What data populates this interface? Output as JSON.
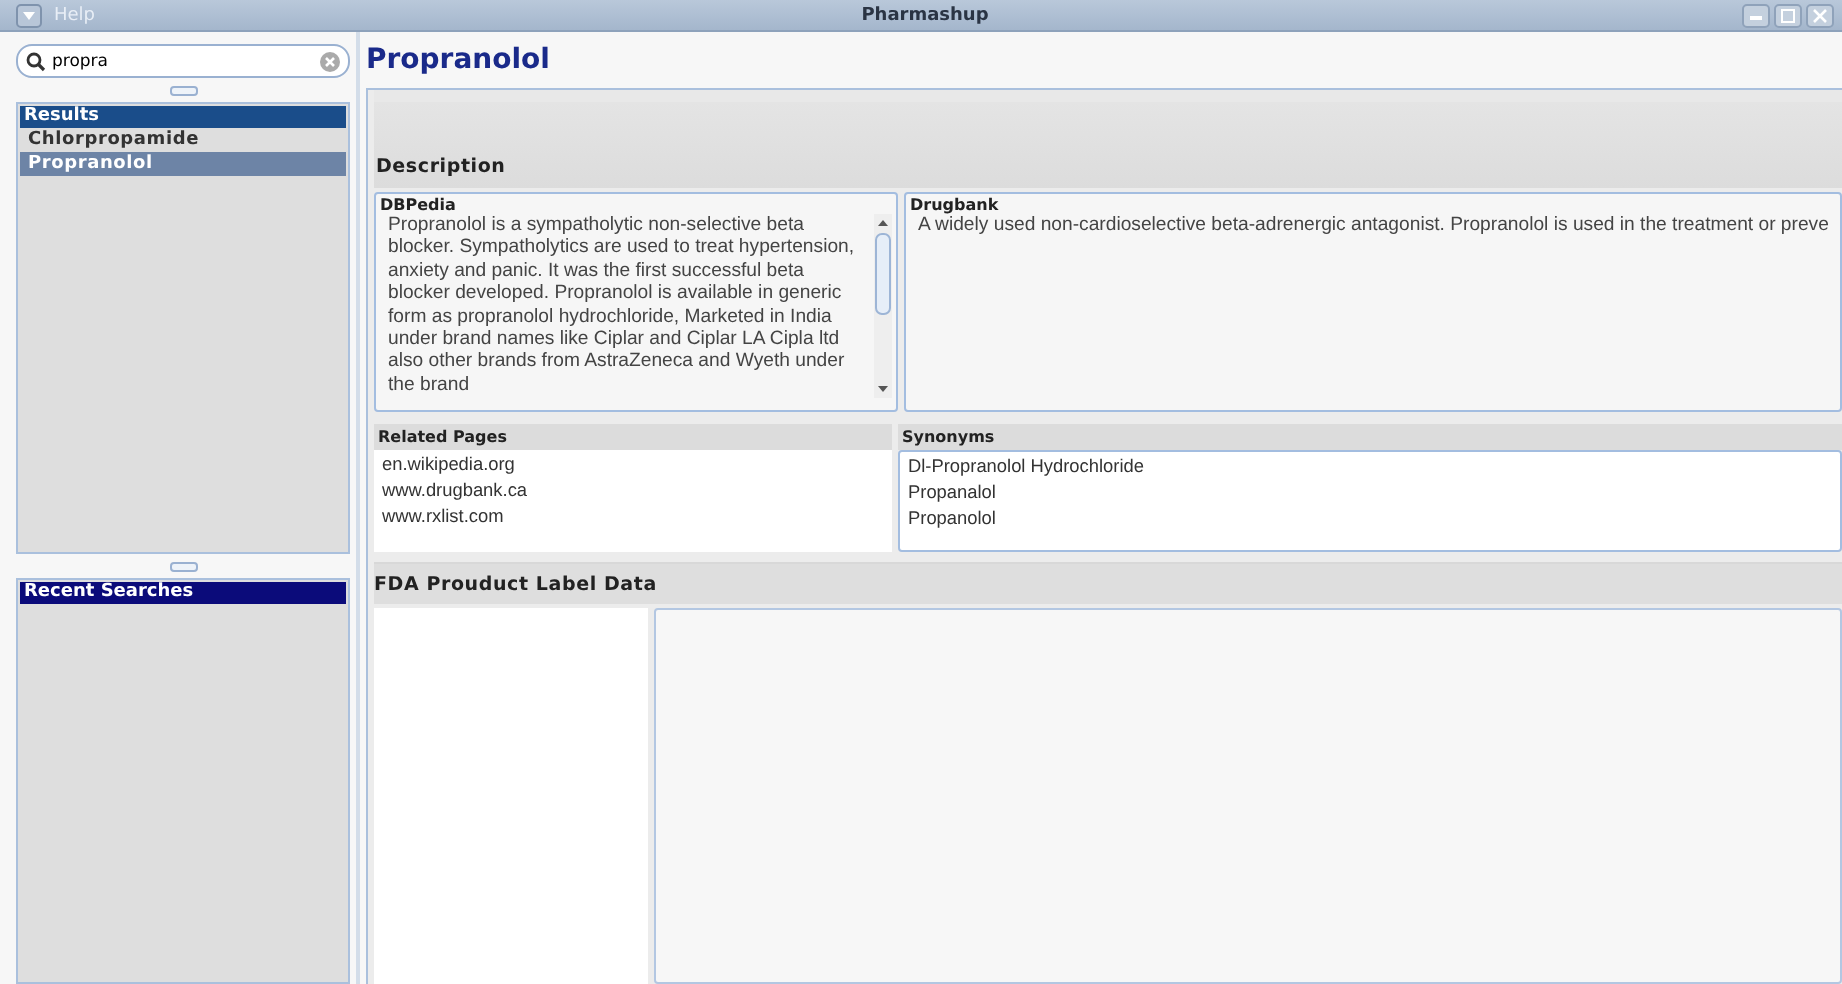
{
  "window": {
    "title": "Pharmashup",
    "menu": "Help"
  },
  "search": {
    "value": "propra"
  },
  "results": {
    "title": "Results",
    "items": [
      {
        "label": "Chlorpropamide",
        "selected": false
      },
      {
        "label": "Propranolol",
        "selected": true
      }
    ]
  },
  "recent_searches": {
    "title": "Recent Searches"
  },
  "drug": {
    "name": "Propranolol"
  },
  "description": {
    "title": "Description",
    "sources": [
      {
        "title": "DBPedia",
        "text": "Propranolol is a sympatholytic non-selective beta blocker. Sympatholytics are used to treat hypertension, anxiety and panic. It was the first successful beta blocker developed. Propranolol is available in generic form as propranolol hydrochloride, Marketed in India under brand names like Ciplar and Ciplar LA Cipla ltd also other brands from AstraZeneca and Wyeth under the brand"
      },
      {
        "title": "Drugbank",
        "text": "A widely used non-cardioselective beta-adrenergic antagonist. Propranolol is used in the treatment or preve"
      }
    ]
  },
  "related_pages": {
    "title": "Related Pages",
    "items": [
      "en.wikipedia.org",
      "www.drugbank.ca",
      "www.rxlist.com"
    ]
  },
  "synonyms": {
    "title": "Synonyms",
    "items": [
      "Dl-Propranolol Hydrochloride",
      "Propanalol",
      "Propanolol"
    ]
  },
  "fda": {
    "title": "FDA Prouduct Label Data"
  }
}
